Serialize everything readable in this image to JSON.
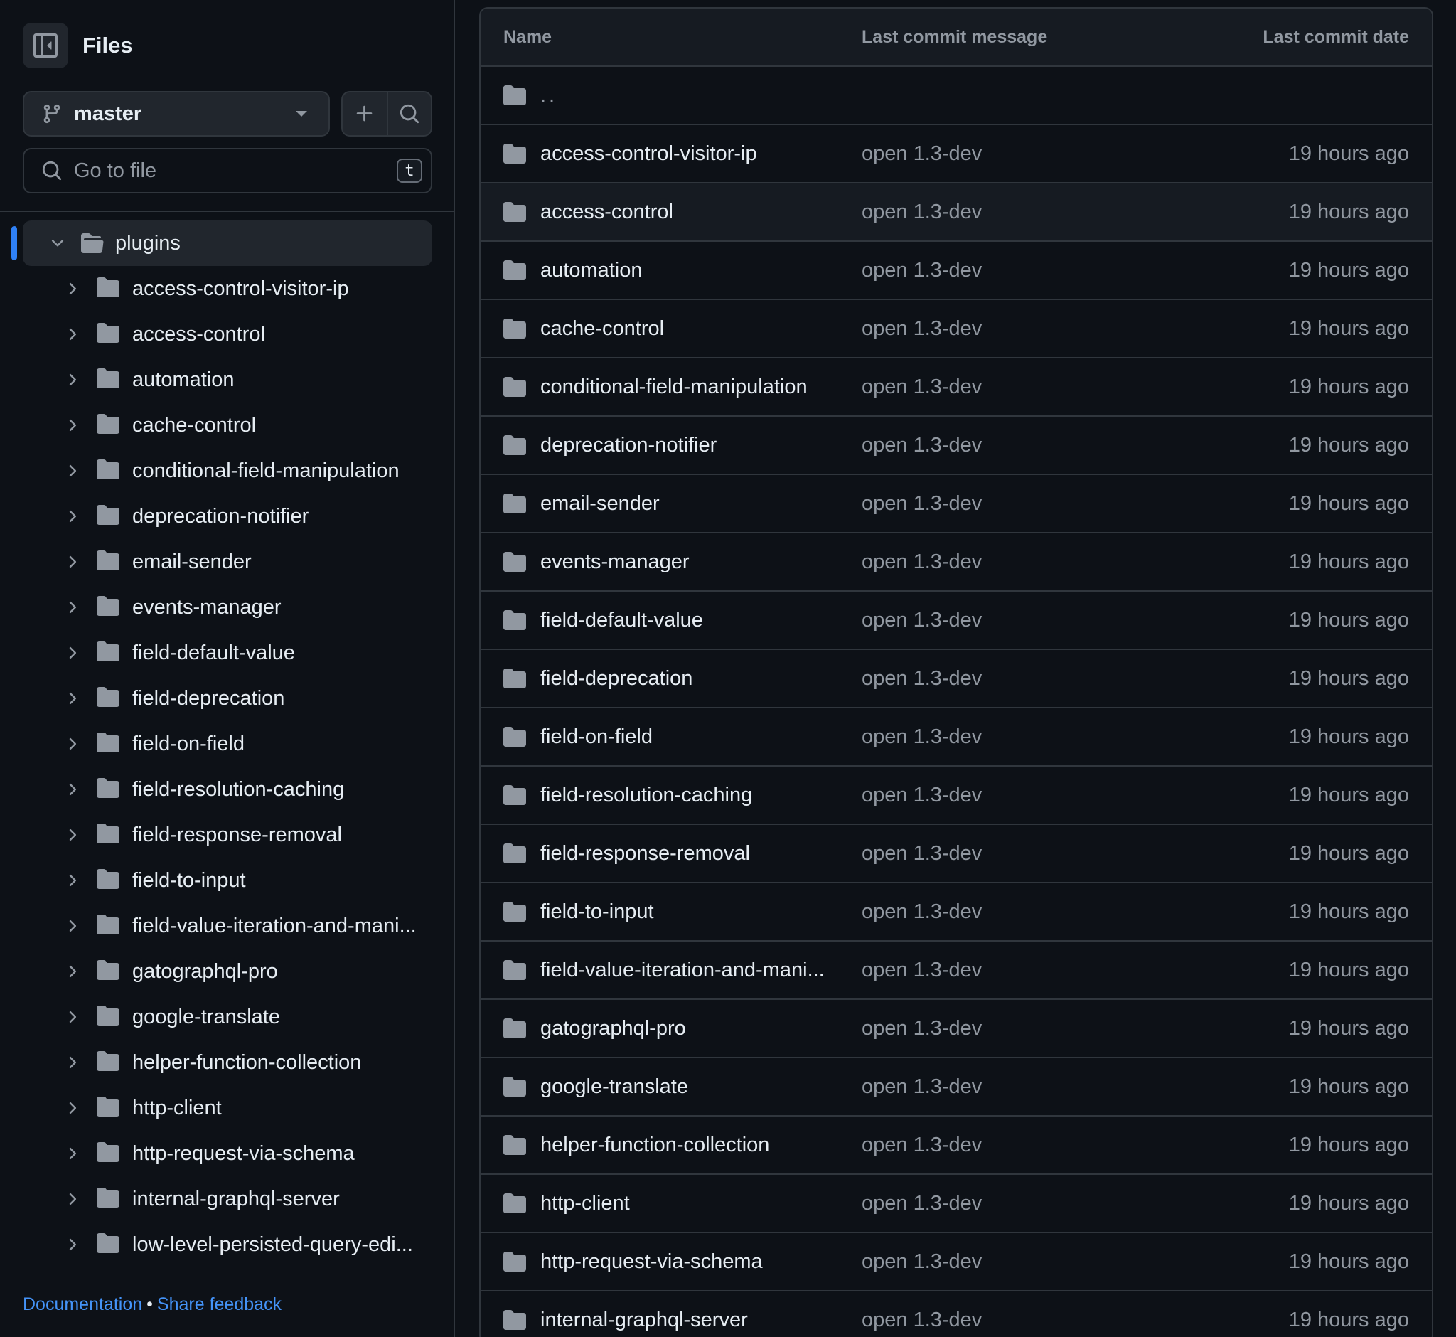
{
  "sidebar": {
    "title": "Files",
    "branch": "master",
    "search_placeholder": "Go to file",
    "search_shortcut": "t",
    "root": {
      "label": "plugins"
    },
    "items": [
      "access-control-visitor-ip",
      "access-control",
      "automation",
      "cache-control",
      "conditional-field-manipulation",
      "deprecation-notifier",
      "email-sender",
      "events-manager",
      "field-default-value",
      "field-deprecation",
      "field-on-field",
      "field-resolution-caching",
      "field-response-removal",
      "field-to-input",
      "field-value-iteration-and-mani...",
      "gatographql-pro",
      "google-translate",
      "helper-function-collection",
      "http-client",
      "http-request-via-schema",
      "internal-graphql-server",
      "low-level-persisted-query-edi..."
    ],
    "footer": {
      "documentation": "Documentation",
      "separator": "•",
      "feedback": "Share feedback"
    }
  },
  "table": {
    "headers": {
      "name": "Name",
      "message": "Last commit message",
      "date": "Last commit date"
    },
    "parent": "..",
    "rows": [
      {
        "name": "access-control-visitor-ip",
        "message": "open 1.3-dev",
        "date": "19 hours ago"
      },
      {
        "name": "access-control",
        "message": "open 1.3-dev",
        "date": "19 hours ago"
      },
      {
        "name": "automation",
        "message": "open 1.3-dev",
        "date": "19 hours ago"
      },
      {
        "name": "cache-control",
        "message": "open 1.3-dev",
        "date": "19 hours ago"
      },
      {
        "name": "conditional-field-manipulation",
        "message": "open 1.3-dev",
        "date": "19 hours ago"
      },
      {
        "name": "deprecation-notifier",
        "message": "open 1.3-dev",
        "date": "19 hours ago"
      },
      {
        "name": "email-sender",
        "message": "open 1.3-dev",
        "date": "19 hours ago"
      },
      {
        "name": "events-manager",
        "message": "open 1.3-dev",
        "date": "19 hours ago"
      },
      {
        "name": "field-default-value",
        "message": "open 1.3-dev",
        "date": "19 hours ago"
      },
      {
        "name": "field-deprecation",
        "message": "open 1.3-dev",
        "date": "19 hours ago"
      },
      {
        "name": "field-on-field",
        "message": "open 1.3-dev",
        "date": "19 hours ago"
      },
      {
        "name": "field-resolution-caching",
        "message": "open 1.3-dev",
        "date": "19 hours ago"
      },
      {
        "name": "field-response-removal",
        "message": "open 1.3-dev",
        "date": "19 hours ago"
      },
      {
        "name": "field-to-input",
        "message": "open 1.3-dev",
        "date": "19 hours ago"
      },
      {
        "name": "field-value-iteration-and-mani...",
        "message": "open 1.3-dev",
        "date": "19 hours ago"
      },
      {
        "name": "gatographql-pro",
        "message": "open 1.3-dev",
        "date": "19 hours ago"
      },
      {
        "name": "google-translate",
        "message": "open 1.3-dev",
        "date": "19 hours ago"
      },
      {
        "name": "helper-function-collection",
        "message": "open 1.3-dev",
        "date": "19 hours ago"
      },
      {
        "name": "http-client",
        "message": "open 1.3-dev",
        "date": "19 hours ago"
      },
      {
        "name": "http-request-via-schema",
        "message": "open 1.3-dev",
        "date": "19 hours ago"
      },
      {
        "name": "internal-graphql-server",
        "message": "open 1.3-dev",
        "date": "19 hours ago"
      }
    ]
  },
  "icons": {
    "panel": "sidebar-collapse-icon",
    "branch": "git-branch-icon",
    "add": "plus-icon",
    "search": "search-icon",
    "folder": "folder-icon",
    "folder_open": "folder-open-icon",
    "chevron": "chevron-right-icon"
  },
  "colors": {
    "accent": "#2f81f7",
    "link": "#4493f8",
    "bg": "#0d1117",
    "border": "#30363d",
    "muted": "#9198a1"
  }
}
